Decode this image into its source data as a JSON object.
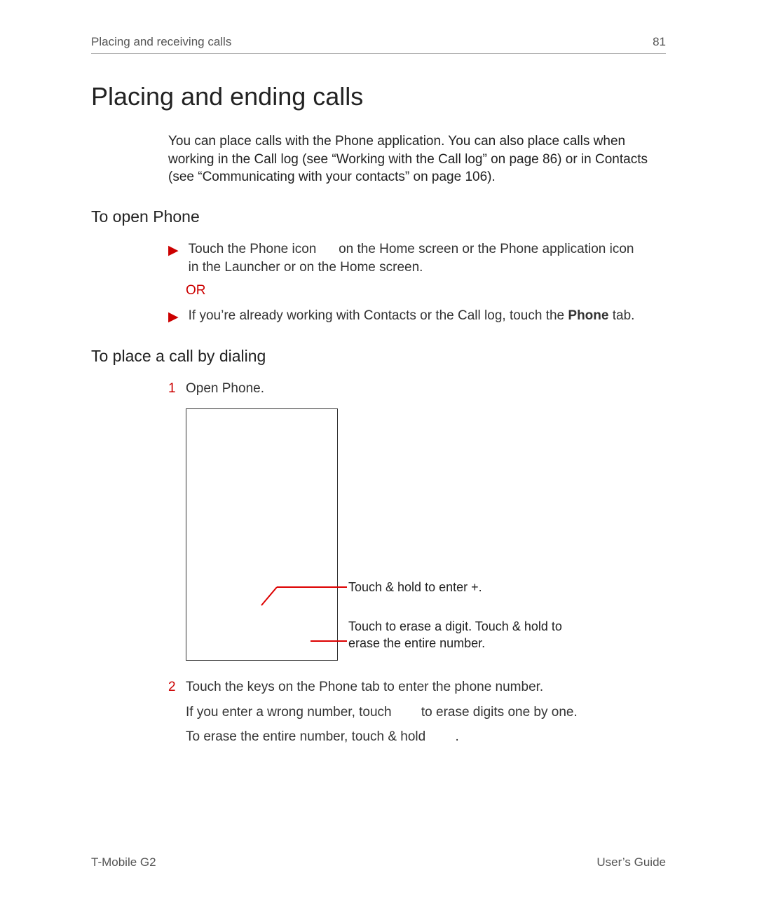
{
  "header": {
    "section": "Placing and receiving calls",
    "page_num": "81"
  },
  "title": "Placing and ending calls",
  "intro": "You can place calls with the Phone application. You can also place calls when working in the Call log (see “Working with the Call log” on page 86) or in Contacts (see “Communicating with your contacts” on page 106).",
  "sections": {
    "open_phone": {
      "heading": "To open Phone",
      "bullet1_a": "Touch the Phone icon ",
      "bullet1_b": " on the Home screen or the Phone application icon ",
      "bullet1_c": " in the Launcher or on the Home screen.",
      "or": "OR",
      "bullet2_a": "If you’re already working with Contacts or the Call log, touch the ",
      "bullet2_phone": "Phone",
      "bullet2_b": "  tab."
    },
    "dialing": {
      "heading": "To place a call by dialing",
      "step1": "Open Phone.",
      "callout1": "Touch & hold to enter +.",
      "callout2": "Touch to erase a digit. Touch & hold to erase the entire number.",
      "step2_a": "Touch the keys on the Phone tab to enter the phone number.",
      "step2_b1": "If you enter a wrong number, touch ",
      "step2_b2": " to erase digits one by one.",
      "step2_c1": "To erase the entire number, touch & hold ",
      "step2_c2": "."
    }
  },
  "footer": {
    "left": "T-Mobile G2",
    "right": "User’s Guide"
  }
}
